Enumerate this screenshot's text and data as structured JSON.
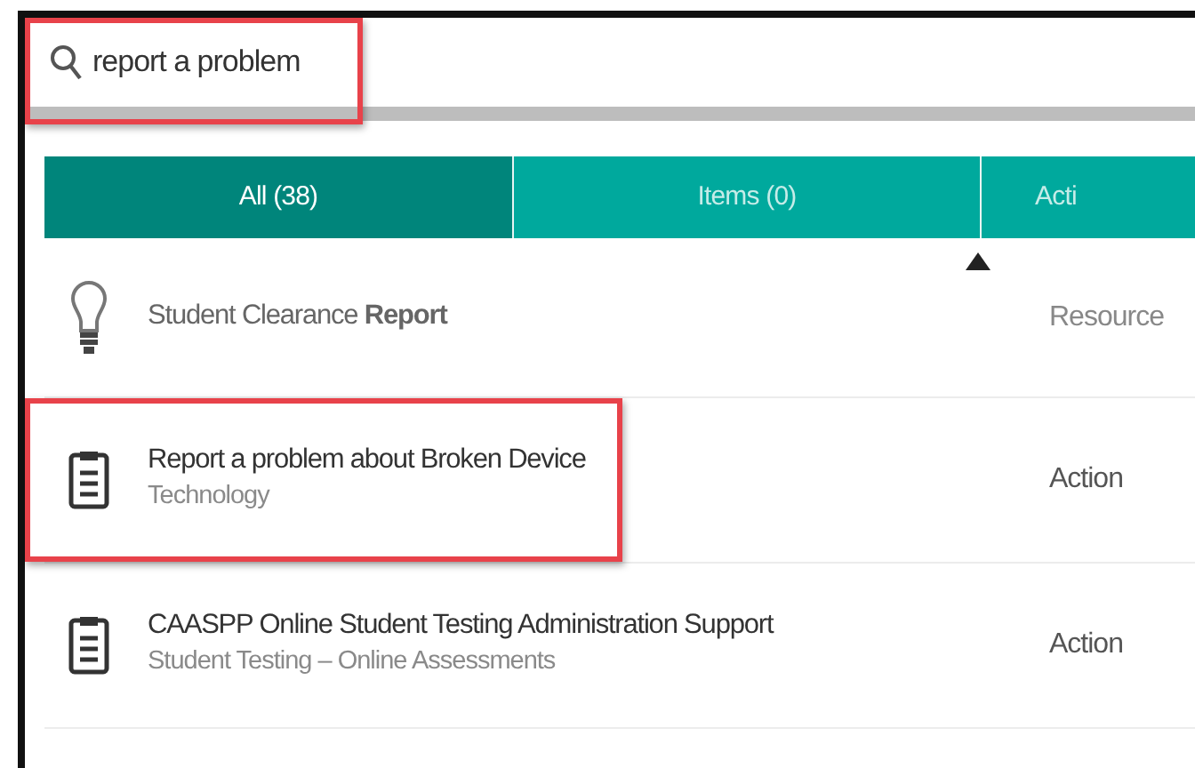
{
  "search": {
    "value": "report a problem",
    "highlighted": true
  },
  "tabs": [
    {
      "label": "All (38)",
      "selected": true
    },
    {
      "label": "Items (0)",
      "selected": false
    },
    {
      "label": "Acti",
      "selected": false
    }
  ],
  "sort": {
    "ascending": true
  },
  "results": [
    {
      "kind": "lightbulb",
      "title": "Student Clearance **Report**",
      "type": "Resource",
      "highlighted": false
    },
    {
      "kind": "clipboard",
      "title": "Report a problem about Broken Device",
      "subtitle": "Technology",
      "type": "Action",
      "highlighted": true
    },
    {
      "kind": "clipboard",
      "title": "CAASPP Online Student Testing Administration Support",
      "subtitle": "Student Testing – Online Assessments",
      "type": "Action",
      "highlighted": false
    }
  ]
}
